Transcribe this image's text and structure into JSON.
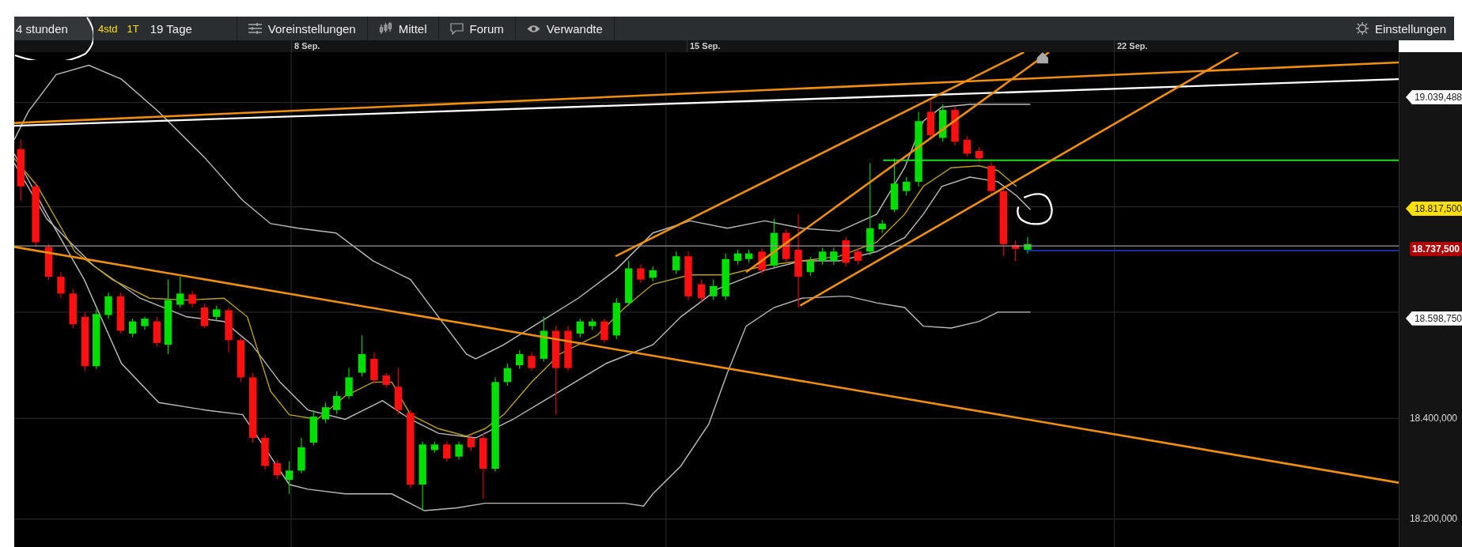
{
  "toolbar": {
    "interval": "4 stunden",
    "quick_ranges": [
      "4std",
      "1T"
    ],
    "range": "19 Tage",
    "buttons": [
      "Voreinstellungen",
      "Mittel",
      "Forum",
      "Verwandte"
    ],
    "settings": "Einstellungen"
  },
  "date_labels": [
    "8 Sep.",
    "15 Sep.",
    "22 Sep."
  ],
  "price_labels": [
    {
      "text": "19.039,488",
      "kind": "tag"
    },
    {
      "text": "18.817,500",
      "kind": "highlight"
    },
    {
      "text": "18.737,500",
      "kind": "last"
    },
    {
      "text": "18.598,750",
      "kind": "tag"
    },
    {
      "text": "18.400,000",
      "kind": "tick"
    },
    {
      "text": "18.200,000",
      "kind": "tick"
    }
  ]
}
